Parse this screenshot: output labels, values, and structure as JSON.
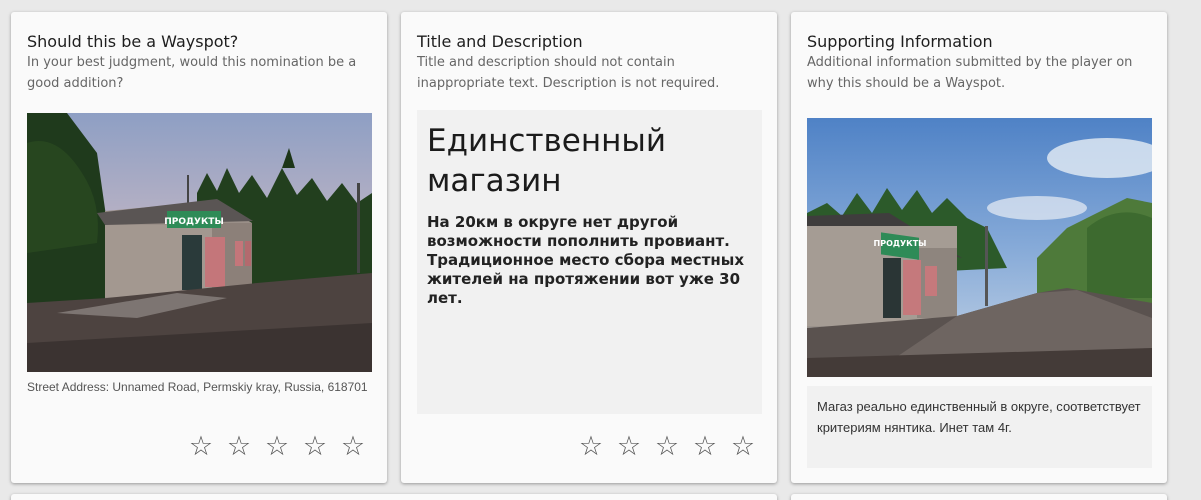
{
  "cards": {
    "wayspot": {
      "title": "Should this be a Wayspot?",
      "subtitle": "In your best judgment, would this nomination be a good addition?",
      "photo_sign": "ПРОДУКТЫ",
      "address": "Street Address: Unnamed Road, Permskiy kray, Russia, 618701",
      "stars": [
        "☆",
        "☆",
        "☆",
        "☆",
        "☆"
      ]
    },
    "title_description": {
      "title": "Title and Description",
      "subtitle": "Title and description should not contain inappropriate text. Description is not required.",
      "nomination_title": "Единственный магазин",
      "nomination_description": "На 20км в округе нет другой возможности пополнить провиант. Традиционное место сбора местных жителей на протяжении вот уже 30 лет.",
      "stars": [
        "☆",
        "☆",
        "☆",
        "☆",
        "☆"
      ]
    },
    "supporting": {
      "title": "Supporting Information",
      "subtitle": "Additional information submitted by the player on why this should be a Wayspot.",
      "photo_sign": "ПРОДУКТЫ",
      "text": "Магаз реально единственный в округе, соответствует критериям нянтика. Инет там 4г."
    }
  },
  "colors": {
    "page_bg": "#e9e9e9",
    "card_bg": "#fafafa",
    "text_box_bg": "#f1f1f1",
    "star": "#555555",
    "sign_green": "#2e8b57"
  },
  "icons": [
    "star-outline-icon"
  ]
}
